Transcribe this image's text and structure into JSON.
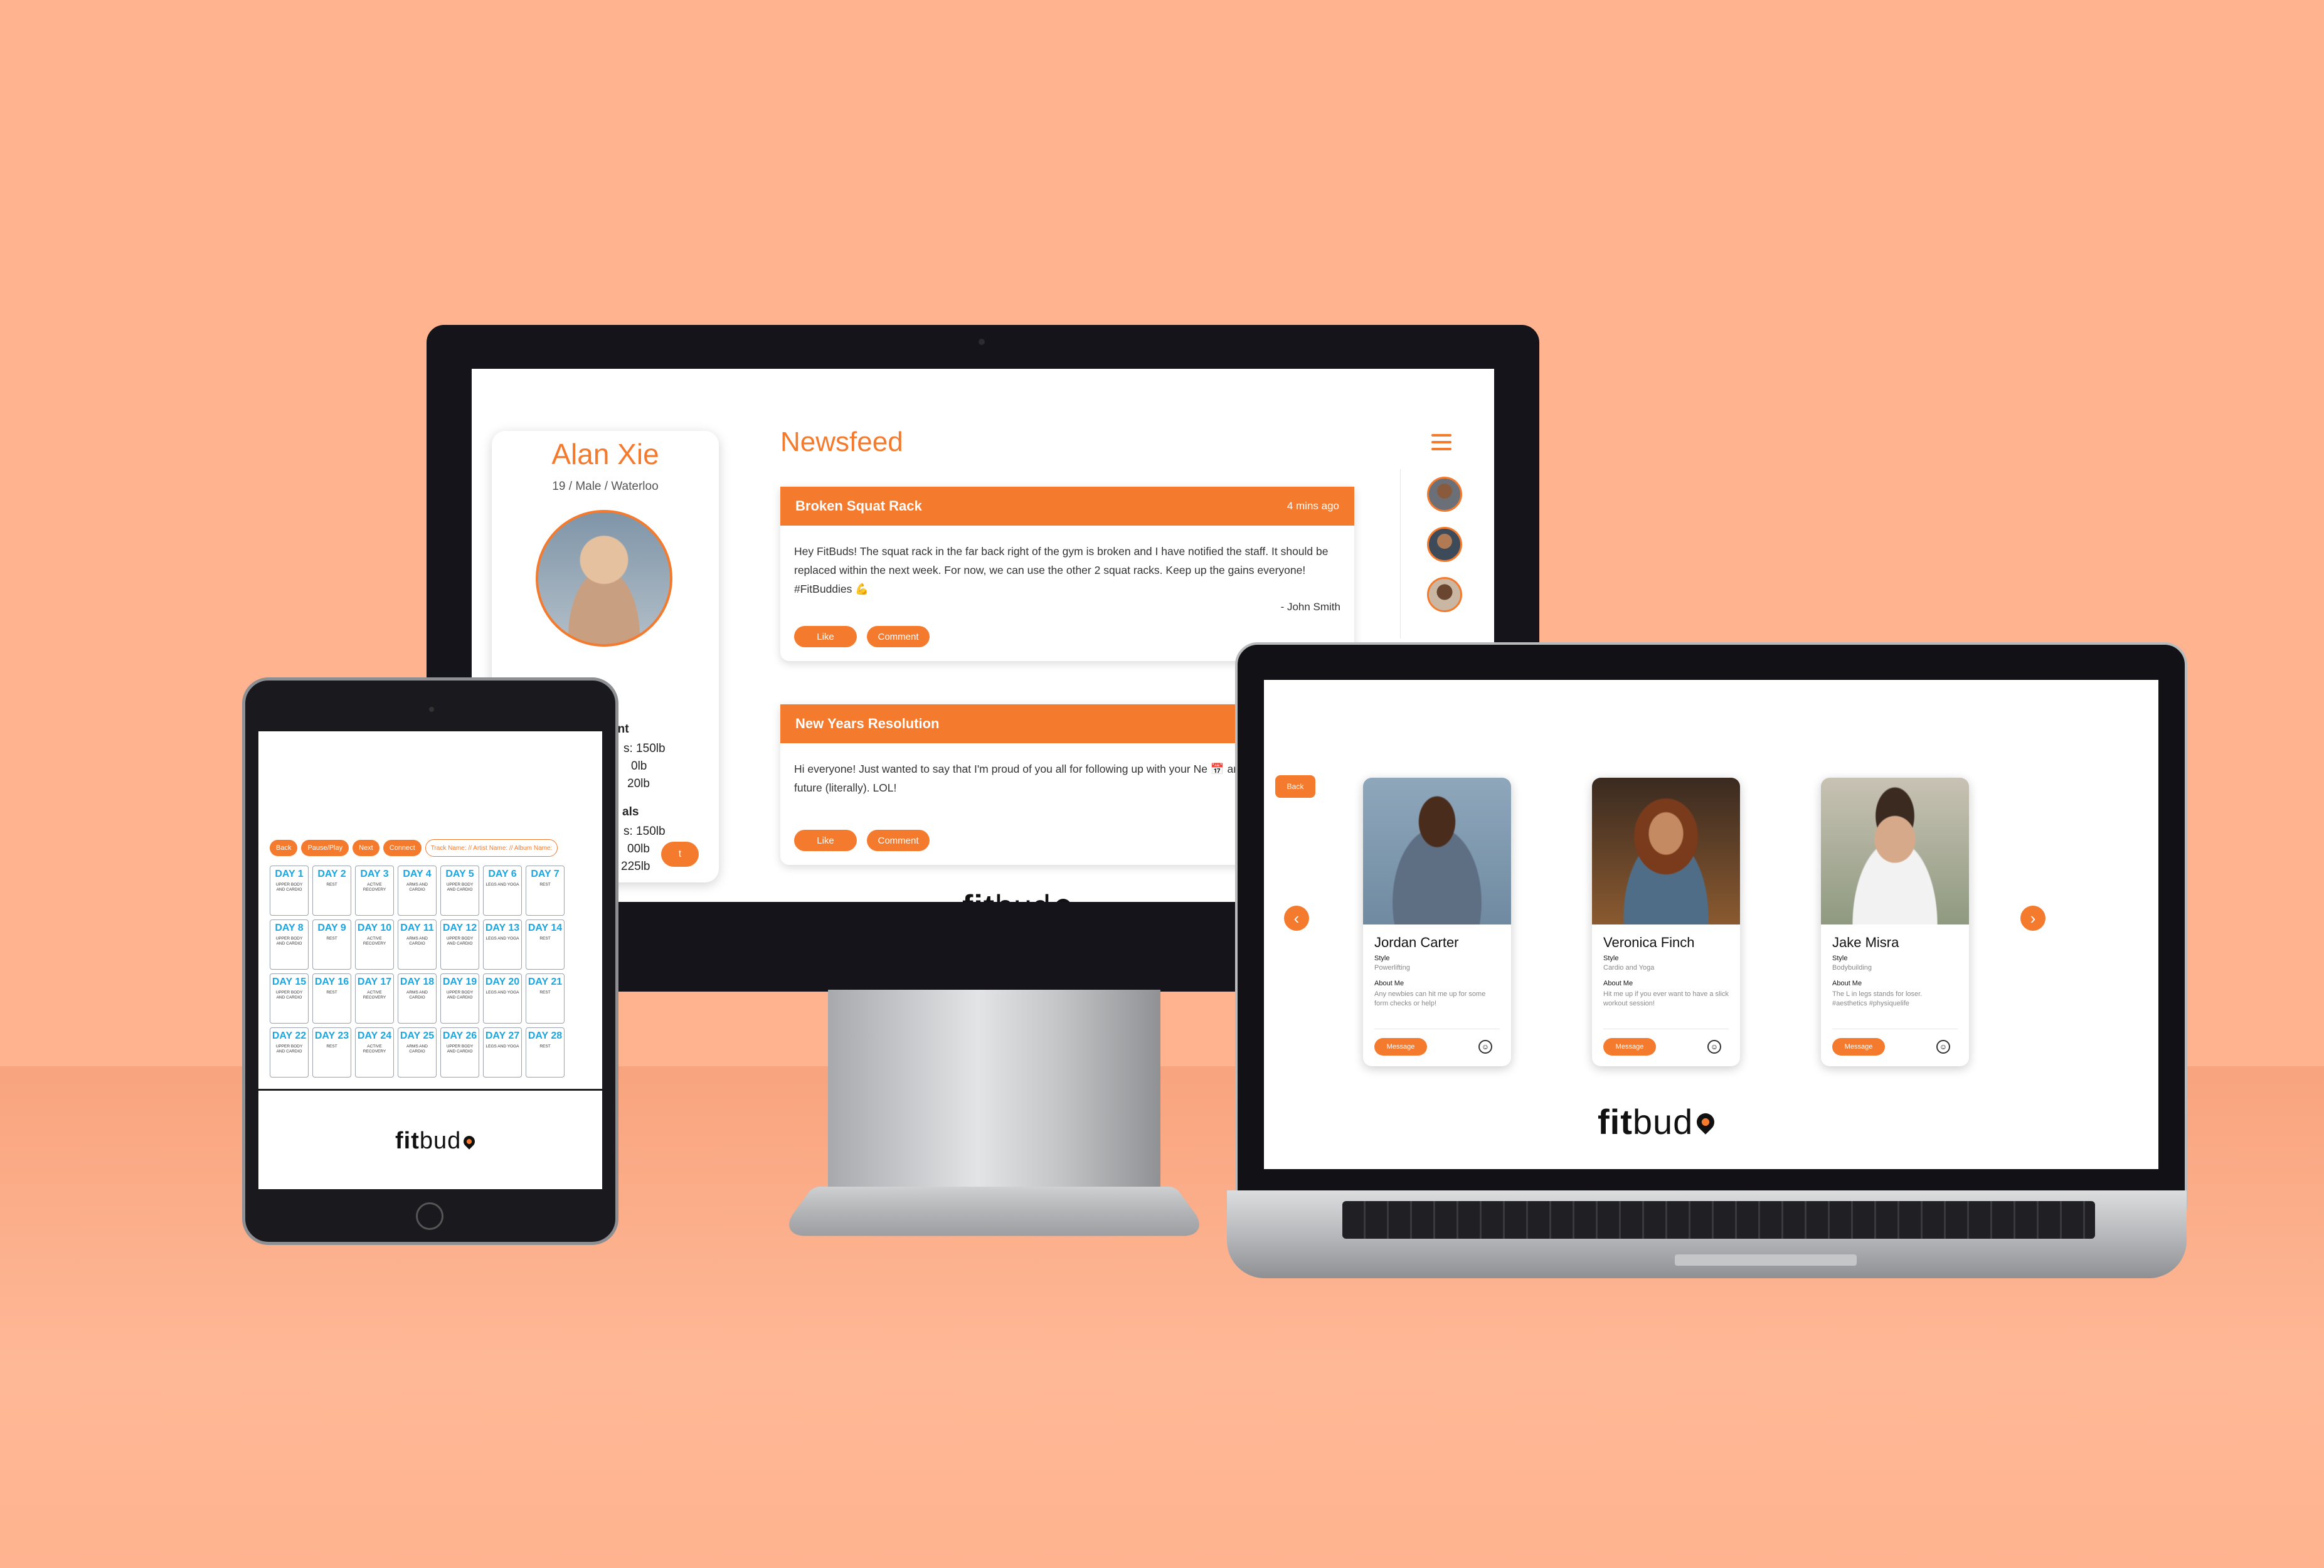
{
  "brand": {
    "logo_prefix": "fit",
    "logo_suffix": "bud",
    "accent": "#f47a2e",
    "day_blue": "#1aa6e0"
  },
  "desktop": {
    "profile": {
      "name": "Alan Xie",
      "meta": "19 / Male / Waterloo",
      "current_label": "Current",
      "current_stats": [
        "s: 150lb",
        "0lb",
        "20lb"
      ],
      "goals_label": "als",
      "goal_stats": [
        "s: 150lb",
        "00lb",
        "225lb"
      ],
      "button_stub": "t"
    },
    "newsfeed_title": "Newsfeed",
    "menu_icon": "hamburger-icon",
    "posts": [
      {
        "title": "Broken Squat Rack",
        "time": "4 mins ago",
        "body": "Hey FitBuds! The squat rack in the far back right of the gym is broken and I have notified the staff. It should be replaced within the next week. For now, we can use the other 2 squat racks. Keep up the gains everyone! #FitBuddies 💪",
        "author": "- John Smith",
        "like": "Like",
        "comment": "Comment"
      },
      {
        "title": "New Years Resolution",
        "time": "",
        "body": "Hi everyone! Just wanted to say that I'm proud of you all for following up with your Ne 📅 and truly shaping your future (literally). LOL!",
        "author": "",
        "like": "Like",
        "comment": "Comment"
      }
    ]
  },
  "tablet": {
    "controls": [
      "Back",
      "Pause/Play",
      "Next",
      "Connect"
    ],
    "track": "Track Name: // Artist Name: // Album Name:",
    "days": [
      {
        "n": "DAY 1",
        "d": "UPPER BODY AND CARDIO"
      },
      {
        "n": "DAY 2",
        "d": "REST"
      },
      {
        "n": "DAY 3",
        "d": "ACTIVE RECOVERY"
      },
      {
        "n": "DAY 4",
        "d": "ARMS AND CARDIO"
      },
      {
        "n": "DAY 5",
        "d": "UPPER BODY AND CARDIO"
      },
      {
        "n": "DAY 6",
        "d": "LEGS AND YOGA"
      },
      {
        "n": "DAY 7",
        "d": "REST"
      },
      {
        "n": "DAY 8",
        "d": "UPPER BODY AND CARDIO"
      },
      {
        "n": "DAY 9",
        "d": "REST"
      },
      {
        "n": "DAY 10",
        "d": "ACTIVE RECOVERY"
      },
      {
        "n": "DAY 11",
        "d": "ARMS AND CARDIO"
      },
      {
        "n": "DAY 12",
        "d": "UPPER BODY AND CARDIO"
      },
      {
        "n": "DAY 13",
        "d": "LEGS AND YOGA"
      },
      {
        "n": "DAY 14",
        "d": "REST"
      },
      {
        "n": "DAY 15",
        "d": "UPPER BODY AND CARDIO"
      },
      {
        "n": "DAY 16",
        "d": "REST"
      },
      {
        "n": "DAY 17",
        "d": "ACTIVE RECOVERY"
      },
      {
        "n": "DAY 18",
        "d": "ARMS AND CARDIO"
      },
      {
        "n": "DAY 19",
        "d": "UPPER BODY AND CARDIO"
      },
      {
        "n": "DAY 20",
        "d": "LEGS AND YOGA"
      },
      {
        "n": "DAY 21",
        "d": "REST"
      },
      {
        "n": "DAY 22",
        "d": "UPPER BODY AND CARDIO"
      },
      {
        "n": "DAY 23",
        "d": "REST"
      },
      {
        "n": "DAY 24",
        "d": "ACTIVE RECOVERY"
      },
      {
        "n": "DAY 25",
        "d": "ARMS AND CARDIO"
      },
      {
        "n": "DAY 26",
        "d": "UPPER BODY AND CARDIO"
      },
      {
        "n": "DAY 27",
        "d": "LEGS AND YOGA"
      },
      {
        "n": "DAY 28",
        "d": "REST"
      }
    ]
  },
  "laptop": {
    "back": "Back",
    "prev_icon": "chevron-left-icon",
    "next_icon": "chevron-right-icon",
    "buddies": [
      {
        "name": "Jordan Carter",
        "style_label": "Style",
        "style": "Powerlifting",
        "about_label": "About Me",
        "about": "Any newbies can hit me up for some form checks or help!",
        "message": "Message"
      },
      {
        "name": "Veronica Finch",
        "style_label": "Style",
        "style": "Cardio and Yoga",
        "about_label": "About Me",
        "about": "Hit me up if you ever want to have a slick workout session!",
        "message": "Message"
      },
      {
        "name": "Jake Misra",
        "style_label": "Style",
        "style": "Bodybuilding",
        "about_label": "About Me",
        "about": "The L in legs stands for loser. #aesthetics #physiquelife",
        "message": "Message"
      }
    ]
  }
}
